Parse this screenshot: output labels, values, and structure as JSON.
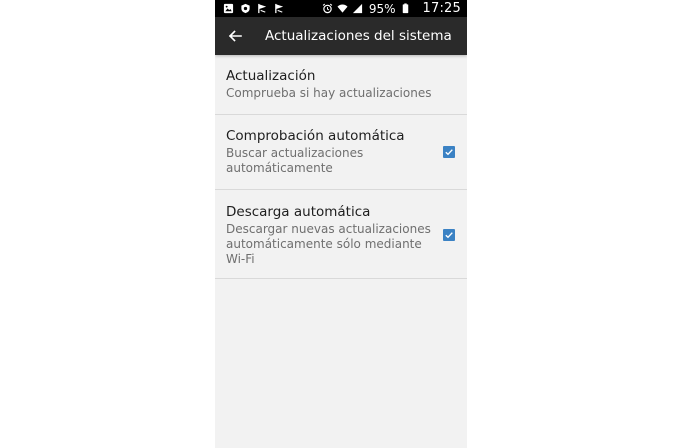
{
  "status_bar": {
    "battery": "95%",
    "time": "17:25",
    "icons": [
      "image-icon",
      "shield-icon",
      "flag-icon",
      "flag-icon",
      "alarm-icon",
      "wifi-icon",
      "signal-icon",
      "battery-icon"
    ]
  },
  "app_bar": {
    "title": "Actualizaciones del sistema",
    "back_icon": "arrow-left-icon"
  },
  "preferences": [
    {
      "title": "Actualización",
      "summary": "Comprueba si hay actualizaciones"
    },
    {
      "title": "Comprobación automática",
      "summary": "Buscar actualizaciones automáticamente",
      "checked": true
    },
    {
      "title": "Descarga automática",
      "summary": "Descargar nuevas actualizaciones automáticamente sólo mediante Wi-Fi",
      "checked": true
    }
  ],
  "colors": {
    "status_bar": "#000000",
    "app_bar": "#2a2a2a",
    "background": "#f2f2f2",
    "checkbox": "#3b82c4"
  }
}
